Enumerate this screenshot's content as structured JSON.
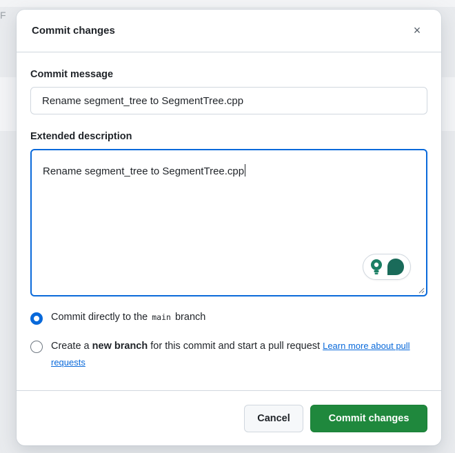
{
  "background": {
    "edge_char": "F"
  },
  "dialog": {
    "title": "Commit changes",
    "close_symbol": "×"
  },
  "commit_message": {
    "label": "Commit message",
    "value": "Rename segment_tree to SegmentTree.cpp"
  },
  "extended_description": {
    "label": "Extended description",
    "value": "Rename segment_tree to SegmentTree.cpp"
  },
  "options": {
    "direct": {
      "prefix": "Commit directly to the ",
      "branch": "main",
      "suffix": " branch",
      "selected": true
    },
    "new_branch": {
      "prefix": "Create a ",
      "bold": "new branch",
      "suffix": " for this commit and start a pull request ",
      "link": "Learn more about pull requests",
      "selected": false
    }
  },
  "buttons": {
    "cancel": "Cancel",
    "commit": "Commit changes"
  },
  "colors": {
    "accent_blue": "#0969da",
    "commit_green": "#1f883d",
    "assistant_teal": "#1a7f64"
  },
  "icons": {
    "close": "close-icon",
    "assistant": "lightbulb-icon",
    "assistant_2": "assistant-bubble-icon",
    "resize": "resize-grip-icon"
  }
}
